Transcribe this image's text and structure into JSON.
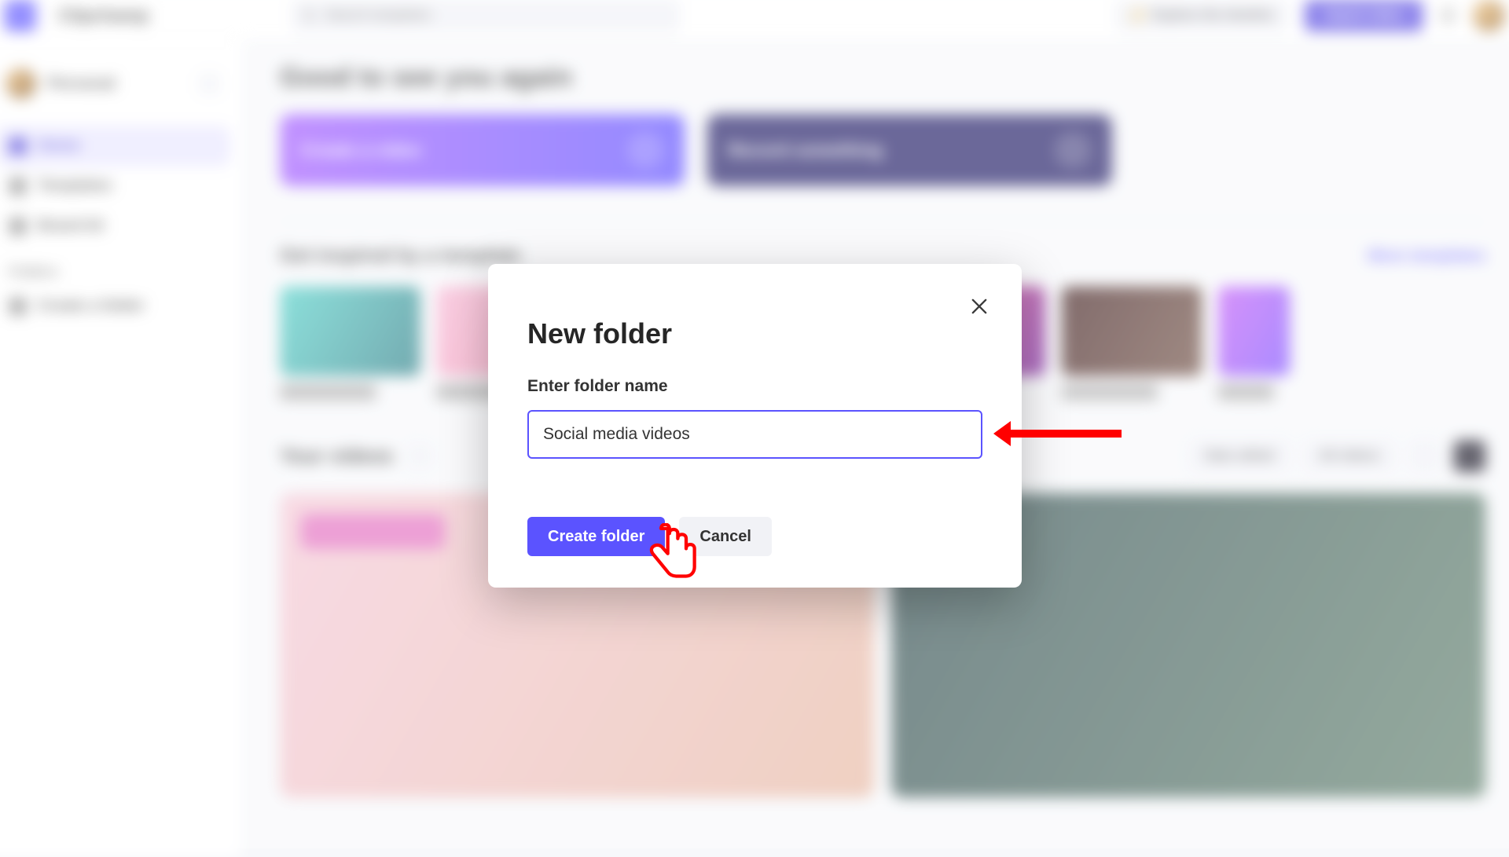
{
  "topbar": {
    "app_name": "Clipchamp",
    "search_placeholder": "Search templates",
    "coachmark_label": "Explore the timeline",
    "import_label": "Import video"
  },
  "sidebar": {
    "workspace_name": "Personal",
    "items": [
      {
        "label": "Home"
      },
      {
        "label": "Templates"
      },
      {
        "label": "Brand kit"
      }
    ],
    "folders_heading": "Folders",
    "folder_item": "Create a folder"
  },
  "main": {
    "greeting": "Good to see you again",
    "hero": [
      {
        "title": "Create a video"
      },
      {
        "title": "Record something"
      }
    ],
    "inspiration_title": "Get inspired by a template",
    "inspiration_more": "More templates",
    "your_videos_title": "Your videos",
    "sort_label": "Date edited",
    "filter_label": "All videos"
  },
  "modal": {
    "title": "New folder",
    "field_label": "Enter folder name",
    "input_value": "Social media videos",
    "create_label": "Create folder",
    "cancel_label": "Cancel"
  },
  "colors": {
    "accent": "#5b53ff",
    "annotation": "#ff0000"
  }
}
